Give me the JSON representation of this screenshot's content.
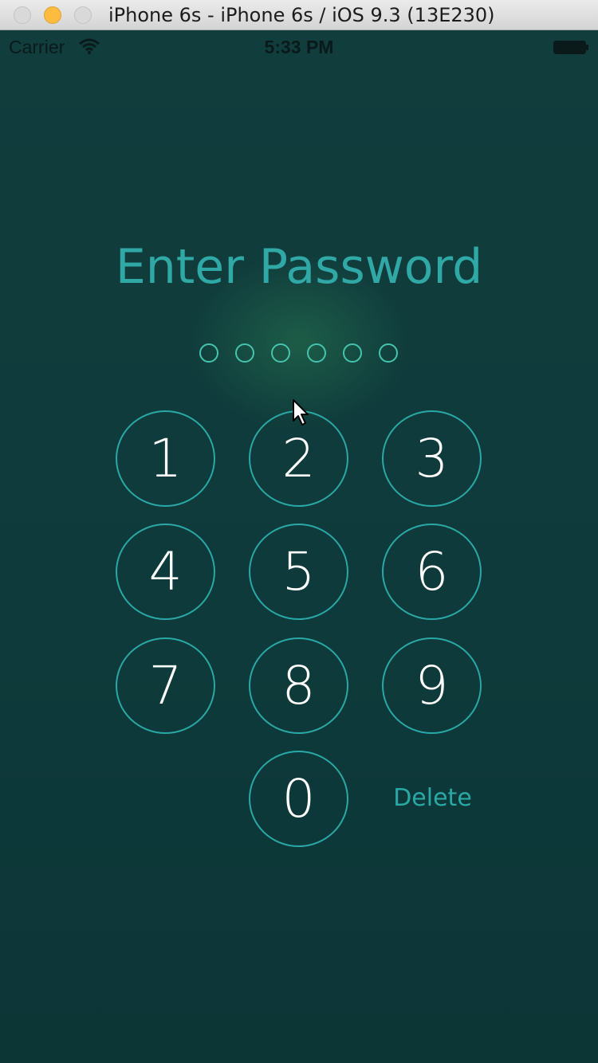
{
  "window": {
    "title": "iPhone 6s - iPhone 6s / iOS 9.3 (13E230)"
  },
  "status_bar": {
    "carrier": "Carrier",
    "time": "5:33 PM"
  },
  "lock": {
    "title": "Enter Password",
    "passcode_length": 6,
    "keys": [
      "1",
      "2",
      "3",
      "4",
      "5",
      "6",
      "7",
      "8",
      "9",
      "0"
    ],
    "delete_label": "Delete"
  },
  "colors": {
    "background": "#0f3a3b",
    "accent": "#2aa8a5",
    "dot": "#45c4ae",
    "digit": "#ffffff"
  }
}
